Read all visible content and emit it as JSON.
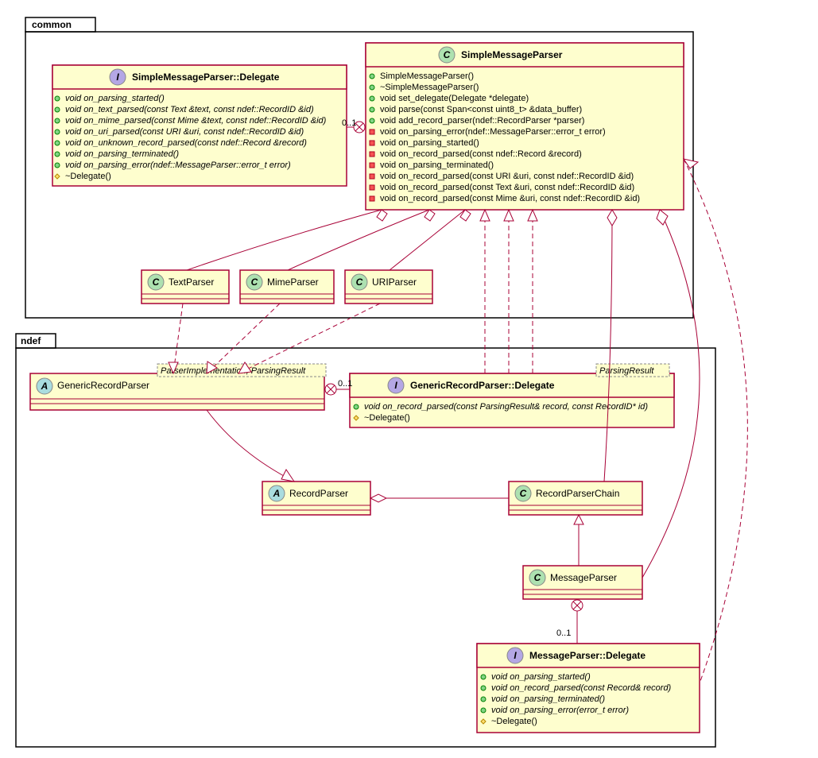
{
  "chart_data": {
    "type": "uml-class-diagram",
    "packages": [
      {
        "name": "common",
        "classes": [
          {
            "name": "SimpleMessageParser::Delegate",
            "kind": "interface",
            "members": [
              {
                "vis": "public",
                "name": "void on_parsing_started()",
                "abstract": true
              },
              {
                "vis": "public",
                "name": "void on_text_parsed(const Text &text, const ndef::RecordID &id)",
                "abstract": true
              },
              {
                "vis": "public",
                "name": "void on_mime_parsed(const Mime &text, const ndef::RecordID &id)",
                "abstract": true
              },
              {
                "vis": "public",
                "name": "void on_uri_parsed(const URI &uri, const ndef::RecordID &id)",
                "abstract": true
              },
              {
                "vis": "public",
                "name": "void on_unknown_record_parsed(const ndef::Record &record)",
                "abstract": true
              },
              {
                "vis": "public",
                "name": "void on_parsing_terminated()",
                "abstract": true
              },
              {
                "vis": "public",
                "name": "void on_parsing_error(ndef::MessageParser::error_t error)",
                "abstract": true
              },
              {
                "vis": "protected",
                "name": "~Delegate()"
              }
            ]
          },
          {
            "name": "SimpleMessageParser",
            "kind": "class",
            "members": [
              {
                "vis": "public",
                "name": "SimpleMessageParser()"
              },
              {
                "vis": "public",
                "name": "~SimpleMessageParser()"
              },
              {
                "vis": "public",
                "name": "void set_delegate(Delegate *delegate)"
              },
              {
                "vis": "public",
                "name": "void parse(const Span<const uint8_t> &data_buffer)"
              },
              {
                "vis": "public",
                "name": "void add_record_parser(ndef::RecordParser *parser)"
              },
              {
                "vis": "private",
                "name": "void on_parsing_error(ndef::MessageParser::error_t error)"
              },
              {
                "vis": "private",
                "name": "void on_parsing_started()"
              },
              {
                "vis": "private",
                "name": "void on_record_parsed(const ndef::Record &record)"
              },
              {
                "vis": "private",
                "name": "void on_parsing_terminated()"
              },
              {
                "vis": "private",
                "name": "void on_record_parsed(const URI &uri, const ndef::RecordID &id)"
              },
              {
                "vis": "private",
                "name": "void on_record_parsed(const Text &uri, const ndef::RecordID &id)"
              },
              {
                "vis": "private",
                "name": "void on_record_parsed(const Mime &uri, const ndef::RecordID &id)"
              }
            ]
          },
          {
            "name": "TextParser",
            "kind": "class"
          },
          {
            "name": "MimeParser",
            "kind": "class"
          },
          {
            "name": "URIParser",
            "kind": "class"
          }
        ]
      },
      {
        "name": "ndef",
        "classes": [
          {
            "name": "GenericRecordParser",
            "kind": "abstract",
            "template": "ParserImplementation, ParsingResult"
          },
          {
            "name": "GenericRecordParser::Delegate",
            "kind": "interface",
            "template": "ParsingResult",
            "members": [
              {
                "vis": "public",
                "name": "void on_record_parsed(const ParsingResult& record, const RecordID* id)",
                "abstract": true
              },
              {
                "vis": "protected",
                "name": "~Delegate()"
              }
            ]
          },
          {
            "name": "RecordParser",
            "kind": "abstract"
          },
          {
            "name": "RecordParserChain",
            "kind": "class"
          },
          {
            "name": "MessageParser",
            "kind": "class"
          },
          {
            "name": "MessageParser::Delegate",
            "kind": "interface",
            "members": [
              {
                "vis": "public",
                "name": "void on_parsing_started()",
                "abstract": true
              },
              {
                "vis": "public",
                "name": "void on_record_parsed(const Record& record)",
                "abstract": true
              },
              {
                "vis": "public",
                "name": "void on_parsing_terminated()",
                "abstract": true
              },
              {
                "vis": "public",
                "name": "void on_parsing_error(error_t error)",
                "abstract": true
              },
              {
                "vis": "protected",
                "name": "~Delegate()"
              }
            ]
          }
        ]
      }
    ],
    "relationships": [
      {
        "from": "SimpleMessageParser",
        "to": "SimpleMessageParser::Delegate",
        "type": "nesting",
        "card": "0..1"
      },
      {
        "from": "SimpleMessageParser",
        "to": "TextParser",
        "type": "aggregation"
      },
      {
        "from": "SimpleMessageParser",
        "to": "MimeParser",
        "type": "aggregation"
      },
      {
        "from": "SimpleMessageParser",
        "to": "URIParser",
        "type": "aggregation"
      },
      {
        "from": "SimpleMessageParser",
        "to": "RecordParserChain",
        "type": "aggregation"
      },
      {
        "from": "SimpleMessageParser",
        "to": "MessageParser",
        "type": "aggregation"
      },
      {
        "from": "SimpleMessageParser",
        "to": "MessageParser::Delegate",
        "type": "realization"
      },
      {
        "from": "SimpleMessageParser",
        "to": "GenericRecordParser::Delegate",
        "type": "realization",
        "count": 3
      },
      {
        "from": "TextParser",
        "to": "GenericRecordParser",
        "type": "realization"
      },
      {
        "from": "MimeParser",
        "to": "GenericRecordParser",
        "type": "realization"
      },
      {
        "from": "URIParser",
        "to": "GenericRecordParser",
        "type": "realization"
      },
      {
        "from": "GenericRecordParser",
        "to": "GenericRecordParser::Delegate",
        "type": "nesting",
        "card": "0..1"
      },
      {
        "from": "GenericRecordParser",
        "to": "RecordParser",
        "type": "generalization"
      },
      {
        "from": "RecordParserChain",
        "to": "RecordParser",
        "type": "aggregation"
      },
      {
        "from": "MessageParser",
        "to": "RecordParserChain",
        "type": "generalization"
      },
      {
        "from": "MessageParser",
        "to": "MessageParser::Delegate",
        "type": "nesting",
        "card": "0..1"
      }
    ]
  },
  "packages": {
    "common": {
      "label": "common"
    },
    "ndef": {
      "label": "ndef"
    }
  },
  "classes": {
    "smp_delegate": {
      "title": "SimpleMessageParser::Delegate",
      "m0": "void on_parsing_started()",
      "m1": "void on_text_parsed(const Text &text, const ndef::RecordID &id)",
      "m2": "void on_mime_parsed(const Mime &text, const ndef::RecordID &id)",
      "m3": "void on_uri_parsed(const URI &uri, const ndef::RecordID &id)",
      "m4": "void on_unknown_record_parsed(const ndef::Record &record)",
      "m5": "void on_parsing_terminated()",
      "m6": "void on_parsing_error(ndef::MessageParser::error_t error)",
      "m7": "~Delegate()"
    },
    "smp": {
      "title": "SimpleMessageParser",
      "m0": "SimpleMessageParser()",
      "m1": "~SimpleMessageParser()",
      "m2": "void set_delegate(Delegate *delegate)",
      "m3": "void parse(const Span<const uint8_t> &data_buffer)",
      "m4": "void add_record_parser(ndef::RecordParser *parser)",
      "m5": "void on_parsing_error(ndef::MessageParser::error_t error)",
      "m6": "void on_parsing_started()",
      "m7": "void on_record_parsed(const ndef::Record &record)",
      "m8": "void on_parsing_terminated()",
      "m9": "void on_record_parsed(const URI &uri, const ndef::RecordID &id)",
      "m10": "void on_record_parsed(const Text &uri, const ndef::RecordID &id)",
      "m11": "void on_record_parsed(const Mime &uri, const ndef::RecordID &id)"
    },
    "textparser": {
      "title": "TextParser"
    },
    "mimeparser": {
      "title": "MimeParser"
    },
    "uriparser": {
      "title": "URIParser"
    },
    "grp": {
      "title": "GenericRecordParser",
      "template": "ParserImplementation, ParsingResult"
    },
    "grp_delegate": {
      "title": "GenericRecordParser::Delegate",
      "template": "ParsingResult",
      "m0": "void on_record_parsed(const ParsingResult& record, const RecordID* id)",
      "m1": "~Delegate()"
    },
    "recordparser": {
      "title": "RecordParser"
    },
    "recordparserchain": {
      "title": "RecordParserChain"
    },
    "messageparser": {
      "title": "MessageParser"
    },
    "mp_delegate": {
      "title": "MessageParser::Delegate",
      "m0": "void on_parsing_started()",
      "m1": "void on_record_parsed(const Record& record)",
      "m2": "void on_parsing_terminated()",
      "m3": "void on_parsing_error(error_t error)",
      "m4": "~Delegate()"
    }
  },
  "card": {
    "zero_one": "0..1"
  }
}
